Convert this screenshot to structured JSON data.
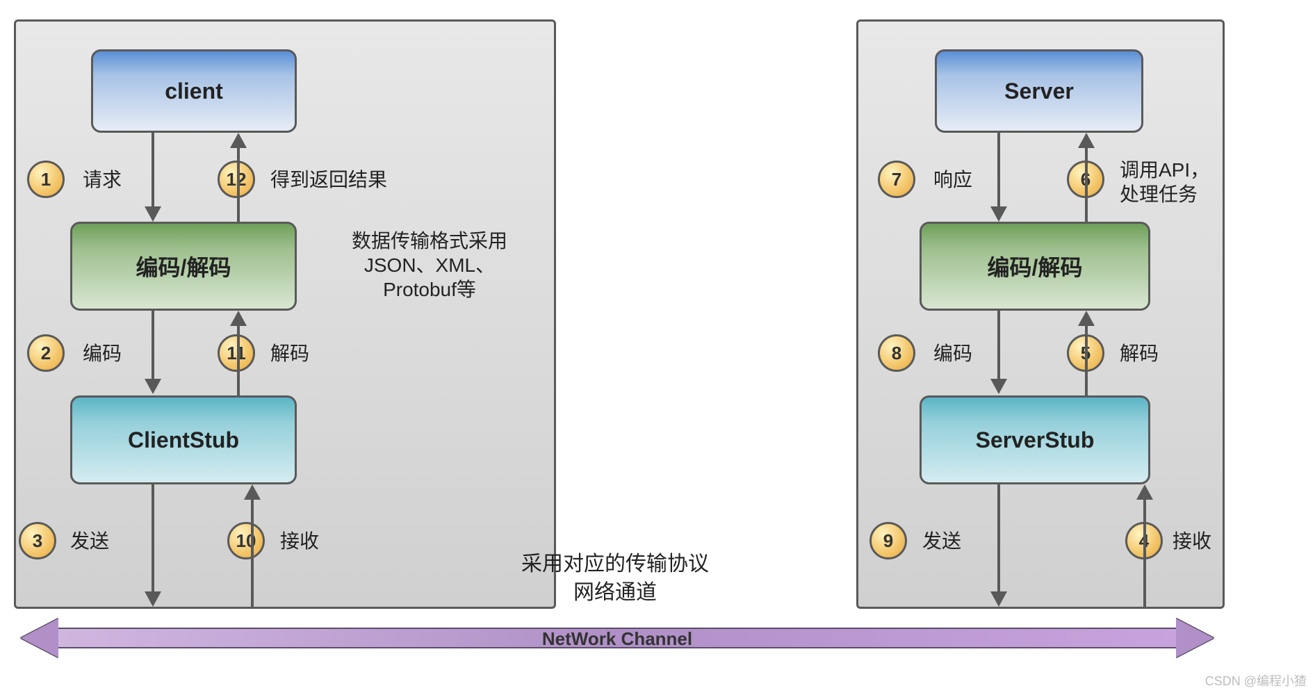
{
  "client_panel": {
    "nodes": {
      "client": "client",
      "codec": "编码/解码",
      "stub": "ClientStub"
    },
    "steps": {
      "s1": {
        "num": "1",
        "label": "请求"
      },
      "s2": {
        "num": "2",
        "label": "编码"
      },
      "s3": {
        "num": "3",
        "label": "发送"
      },
      "s10": {
        "num": "10",
        "label": "接收"
      },
      "s11": {
        "num": "11",
        "label": "解码"
      },
      "s12": {
        "num": "12",
        "label": "得到返回结果"
      }
    },
    "annotation": "数据传输格式采用\nJSON、XML、\nProtobuf等"
  },
  "server_panel": {
    "nodes": {
      "server": "Server",
      "codec": "编码/解码",
      "stub": "ServerStub"
    },
    "steps": {
      "s4": {
        "num": "4",
        "label": "接收"
      },
      "s5": {
        "num": "5",
        "label": "解码"
      },
      "s6": {
        "num": "6",
        "label": "调用API，\n处理任务"
      },
      "s7": {
        "num": "7",
        "label": "响应"
      },
      "s8": {
        "num": "8",
        "label": "编码"
      },
      "s9": {
        "num": "9",
        "label": "发送"
      }
    }
  },
  "center": {
    "protocol": "采用对应的传输协议\n网络通道"
  },
  "channel": {
    "label": "NetWork  Channel"
  },
  "watermark": "CSDN @编程小猹"
}
